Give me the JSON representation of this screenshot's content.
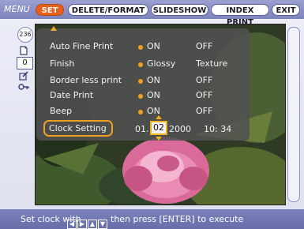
{
  "menu": {
    "label": "MENU",
    "tabs": [
      "SET",
      "DELETE/FORMAT",
      "SLIDESHOW",
      "INDEX PRINT",
      "EXIT"
    ],
    "active_tab": "SET"
  },
  "sidebar": {
    "image_count": "236",
    "copies": "0",
    "icons": [
      "print-icon",
      "edit-icon",
      "key-icon"
    ]
  },
  "settings": [
    {
      "label": "Auto Fine Print",
      "selected": "ON",
      "other": "OFF"
    },
    {
      "label": "Finish",
      "selected": "Glossy",
      "other": "Texture"
    },
    {
      "label": "Border less print",
      "selected": "ON",
      "other": "OFF"
    },
    {
      "label": "Date Print",
      "selected": "ON",
      "other": "OFF"
    },
    {
      "label": "Beep",
      "selected": "ON",
      "other": "OFF"
    }
  ],
  "clock": {
    "label": "Clock Setting",
    "month": "01.",
    "day": "02",
    "year": "2000",
    "time": "10: 34"
  },
  "status": {
    "prefix": "Set clock with",
    "keys": [
      "◀",
      "▶",
      "▲",
      "▼"
    ],
    "suffix": "then press [ENTER] to execute"
  },
  "colors": {
    "accent": "#e8601c",
    "highlight": "#f0a020",
    "bar": "#7d83bc"
  }
}
